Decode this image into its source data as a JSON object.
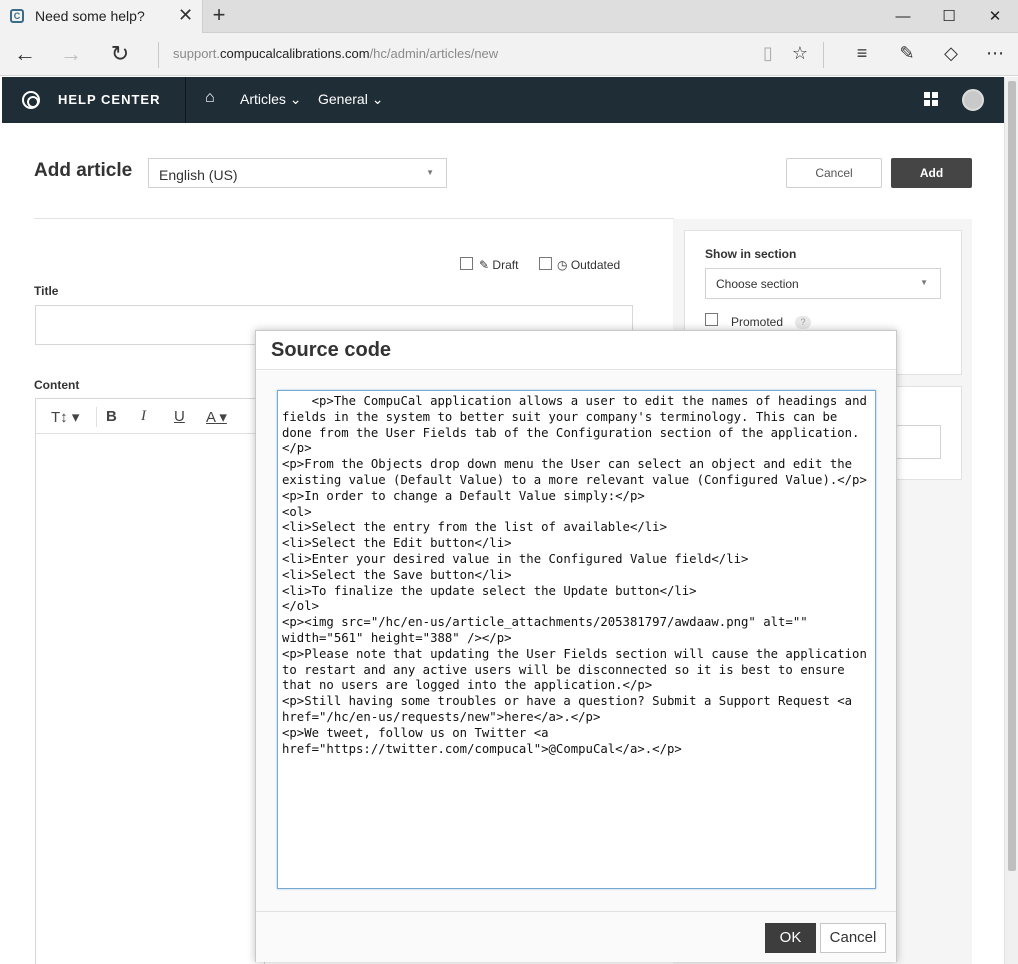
{
  "browser": {
    "tab_title": "Need some help?",
    "tab_close": "✕",
    "new_tab": "+",
    "url_prefix": "support.",
    "url_domain": "compucalcalibrations.com",
    "url_path": "/hc/admin/articles/new",
    "minimize": "—",
    "maximize": "☐",
    "close": "✕",
    "favicon": "C"
  },
  "header": {
    "title": "HELP CENTER",
    "nav": [
      "Articles",
      "General"
    ],
    "caret": "⌄"
  },
  "page": {
    "title": "Add article",
    "locale": "English (US)",
    "cancel": "Cancel",
    "add": "Add",
    "draft": "Draft",
    "outdated": "Outdated",
    "title_label": "Title",
    "content_label": "Content"
  },
  "toolbar": {
    "text_size": "T↕",
    "bold": "B",
    "italic": "I",
    "underline": "U",
    "color": "A"
  },
  "sidebar": {
    "section_label": "Show in section",
    "section_select": "Choose section",
    "promoted": "Promoted",
    "help": "?"
  },
  "modal": {
    "title": "Source code",
    "code": "    <p>The CompuCal application allows a user to edit the names of headings and fields in the system to better suit your company's terminology. This can be done from the User Fields tab of the Configuration section of the application.</p>\n<p>From the Objects drop down menu the User can select an object and edit the existing value (Default Value) to a more relevant value (Configured Value).</p>\n<p>In order to change a Default Value simply:</p>\n<ol>\n<li>Select the entry from the list of available</li>\n<li>Select the Edit button</li>\n<li>Enter your desired value in the Configured Value field</li>\n<li>Select the Save button</li>\n<li>To finalize the update select the Update button</li>\n</ol>\n<p><img src=\"/hc/en-us/article_attachments/205381797/awdaaw.png\" alt=\"\" width=\"561\" height=\"388\" /></p>\n<p>Please note that updating the User Fields section will cause the application to restart and any active users will be disconnected so it is best to ensure that no users are logged into the application.</p>\n<p>Still having some troubles or have a question? Submit a Support Request <a href=\"/hc/en-us/requests/new\">here</a>.</p>\n<p>We tweet, follow us on Twitter <a href=\"https://twitter.com/compucal\">@CompuCal</a>.</p>",
    "ok": "OK",
    "cancel": "Cancel"
  },
  "colors": {
    "header_bg": "#1f2d37",
    "primary_button": "#454545",
    "focus_border": "#78a9d2"
  }
}
